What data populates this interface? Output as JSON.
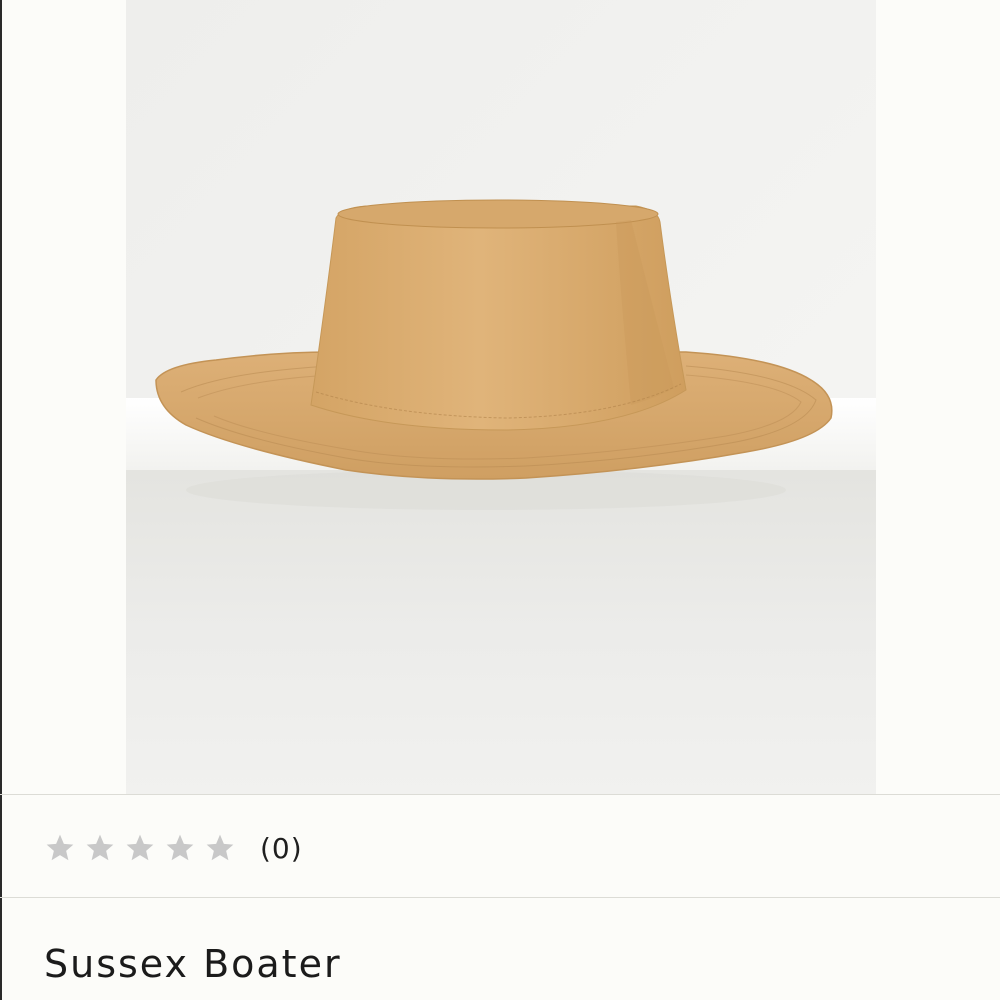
{
  "product": {
    "image_alt": "Sussex Boater hat in tan suede",
    "name": "Sussex Boater",
    "rating": {
      "stars_filled": 0,
      "stars_total": 5,
      "count_text": "(0)"
    }
  },
  "colors": {
    "page_background": "#fcfcf9",
    "hat_tan": "#d9aa6e",
    "star_empty": "#c8c8c8",
    "divider": "#dcdcd6"
  }
}
